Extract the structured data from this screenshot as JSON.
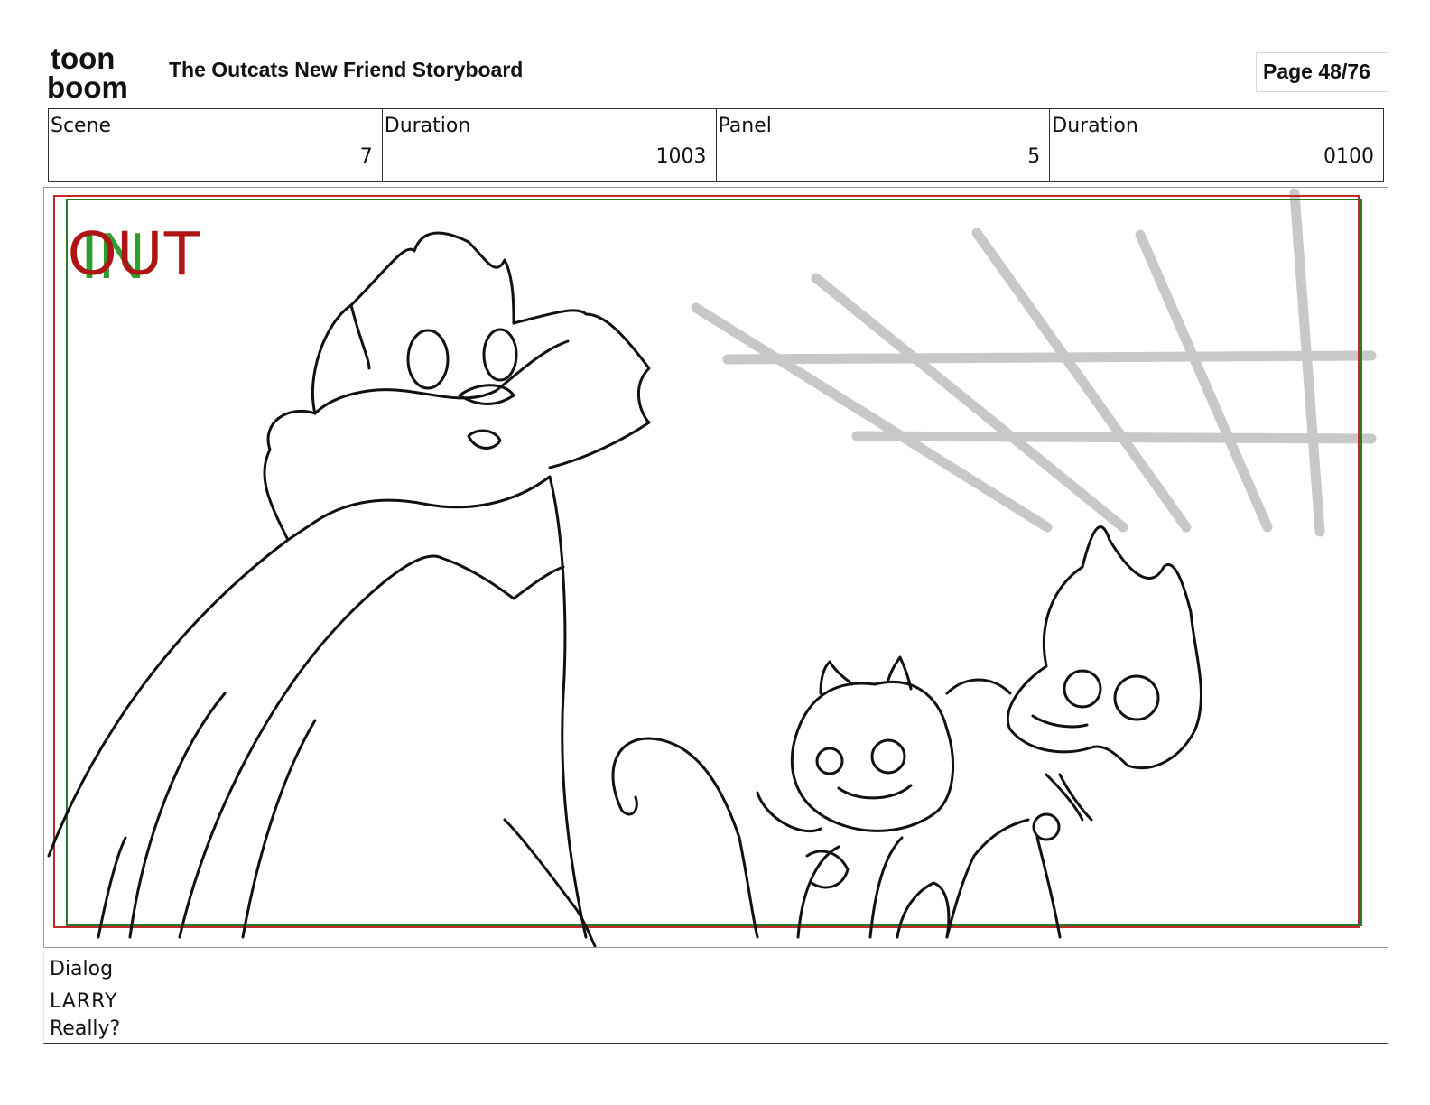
{
  "header": {
    "logo_text_top": "toon",
    "logo_text_bottom": "boom",
    "title": "The Outcats New Friend Storyboard",
    "page": "Page 48/76"
  },
  "info": {
    "scene_label": "Scene",
    "scene_value": "7",
    "scene_duration_label": "Duration",
    "scene_duration_value": "1003",
    "panel_label": "Panel",
    "panel_value": "5",
    "panel_duration_label": "Duration",
    "panel_duration_value": "0100"
  },
  "panel": {
    "marker_in": "IN",
    "marker_out": "OUT",
    "colors": {
      "in_marker": "#2e9e2e",
      "out_marker": "#b01515",
      "safe_frame_red": "#c0282b",
      "safe_frame_green": "#2a7a2a",
      "sketch_gray": "#c8c8c8"
    }
  },
  "dialog": {
    "label": "Dialog",
    "speaker": "LARRY",
    "line": "Really?"
  }
}
